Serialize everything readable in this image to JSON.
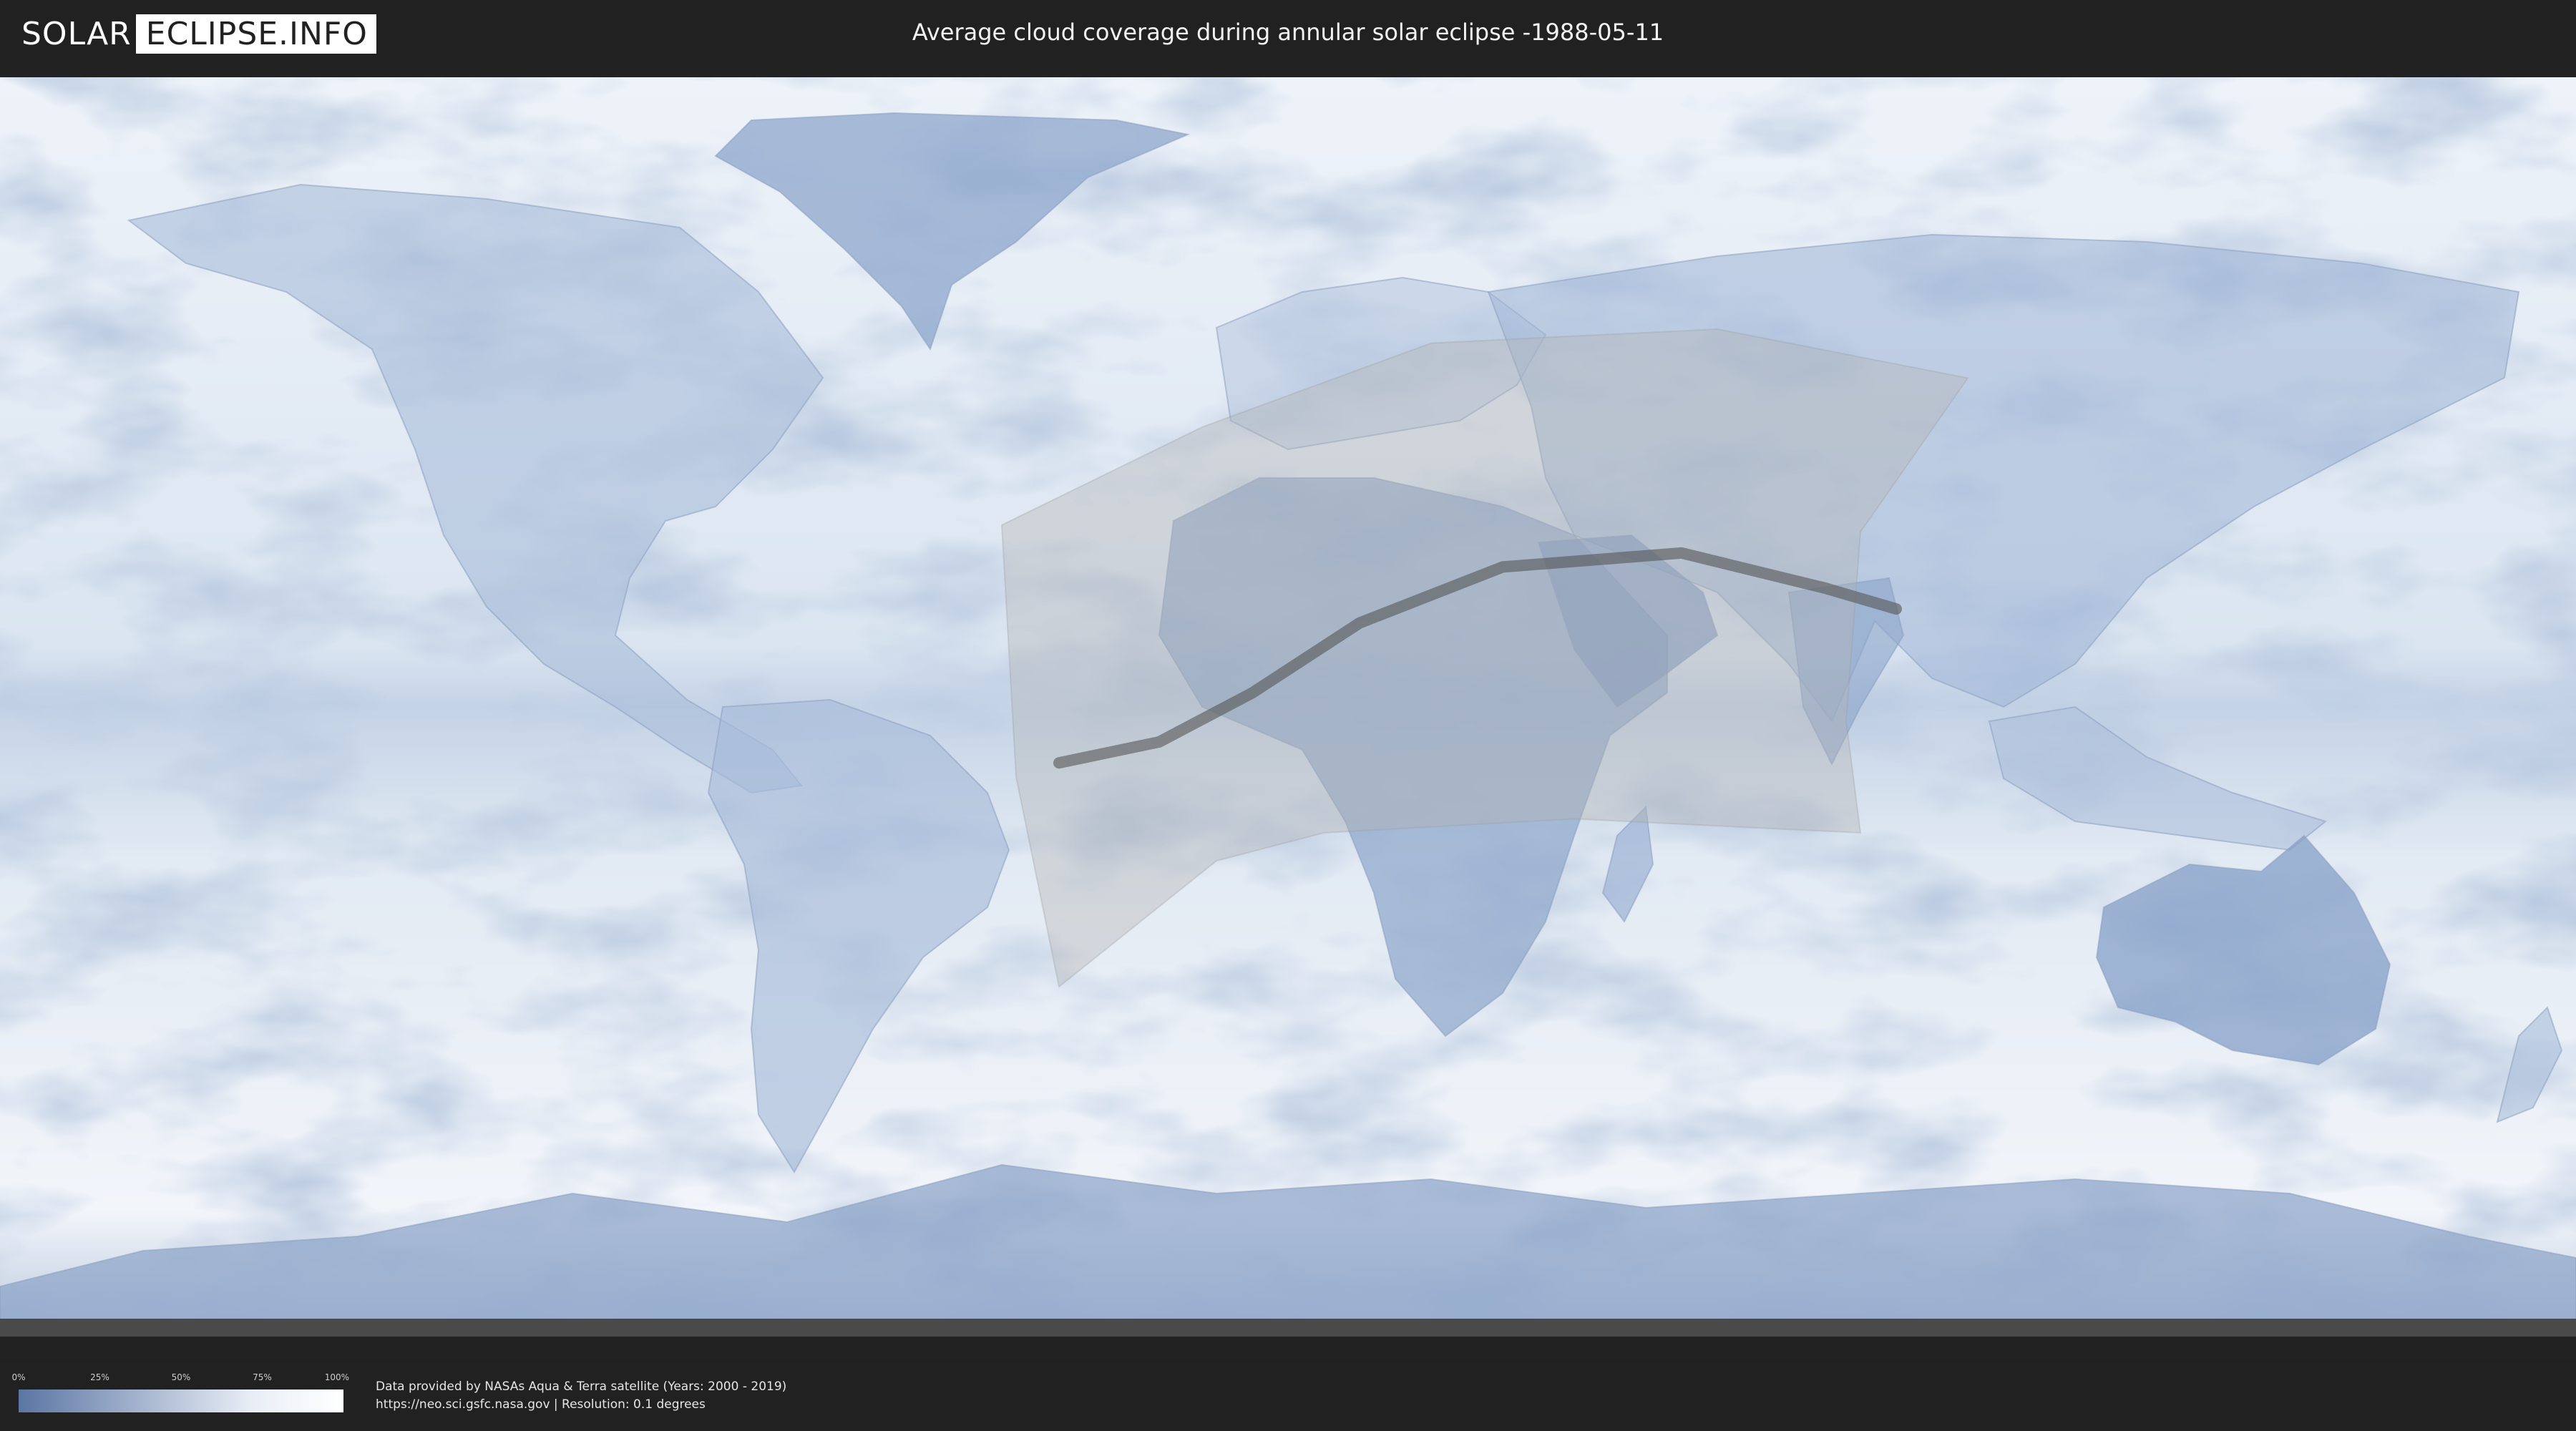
{
  "header": {
    "logo": {
      "part1": "SOLAR",
      "part2": "ECLIPSE.INFO"
    },
    "title": "Average cloud coverage during annular solar eclipse -1988-05-11"
  },
  "legend": {
    "ticks": [
      "0%",
      "25%",
      "50%",
      "75%",
      "100%"
    ],
    "colors": {
      "low": "#5b76a3",
      "high": "#ffffff"
    }
  },
  "credits": {
    "line1": "Data provided by NASAs Aqua & Terra satellite (Years: 2000 - 2019)",
    "line2": "https://neo.sci.gsfc.nasa.gov | Resolution: 0.1 degrees"
  },
  "map": {
    "projection": "equirectangular",
    "colors": {
      "cloud": "#f4f7fb",
      "clear": "#7d97bf",
      "path": "#555555",
      "visibility": "#b4b4b4"
    },
    "eclipse_path": [
      [
        -32,
        -8
      ],
      [
        -18,
        -5
      ],
      [
        -5,
        2
      ],
      [
        10,
        12
      ],
      [
        30,
        20
      ],
      [
        55,
        22
      ],
      [
        75,
        17
      ],
      [
        85,
        14
      ]
    ],
    "visibility_zone": [
      [
        -40,
        26
      ],
      [
        -12,
        40
      ],
      [
        20,
        52
      ],
      [
        60,
        54
      ],
      [
        95,
        47
      ],
      [
        80,
        25
      ],
      [
        78,
        -2
      ],
      [
        80,
        -18
      ],
      [
        40,
        -16
      ],
      [
        5,
        -18
      ],
      [
        -10,
        -22
      ],
      [
        -32,
        -40
      ],
      [
        -38,
        -10
      ],
      [
        -40,
        26
      ]
    ]
  }
}
